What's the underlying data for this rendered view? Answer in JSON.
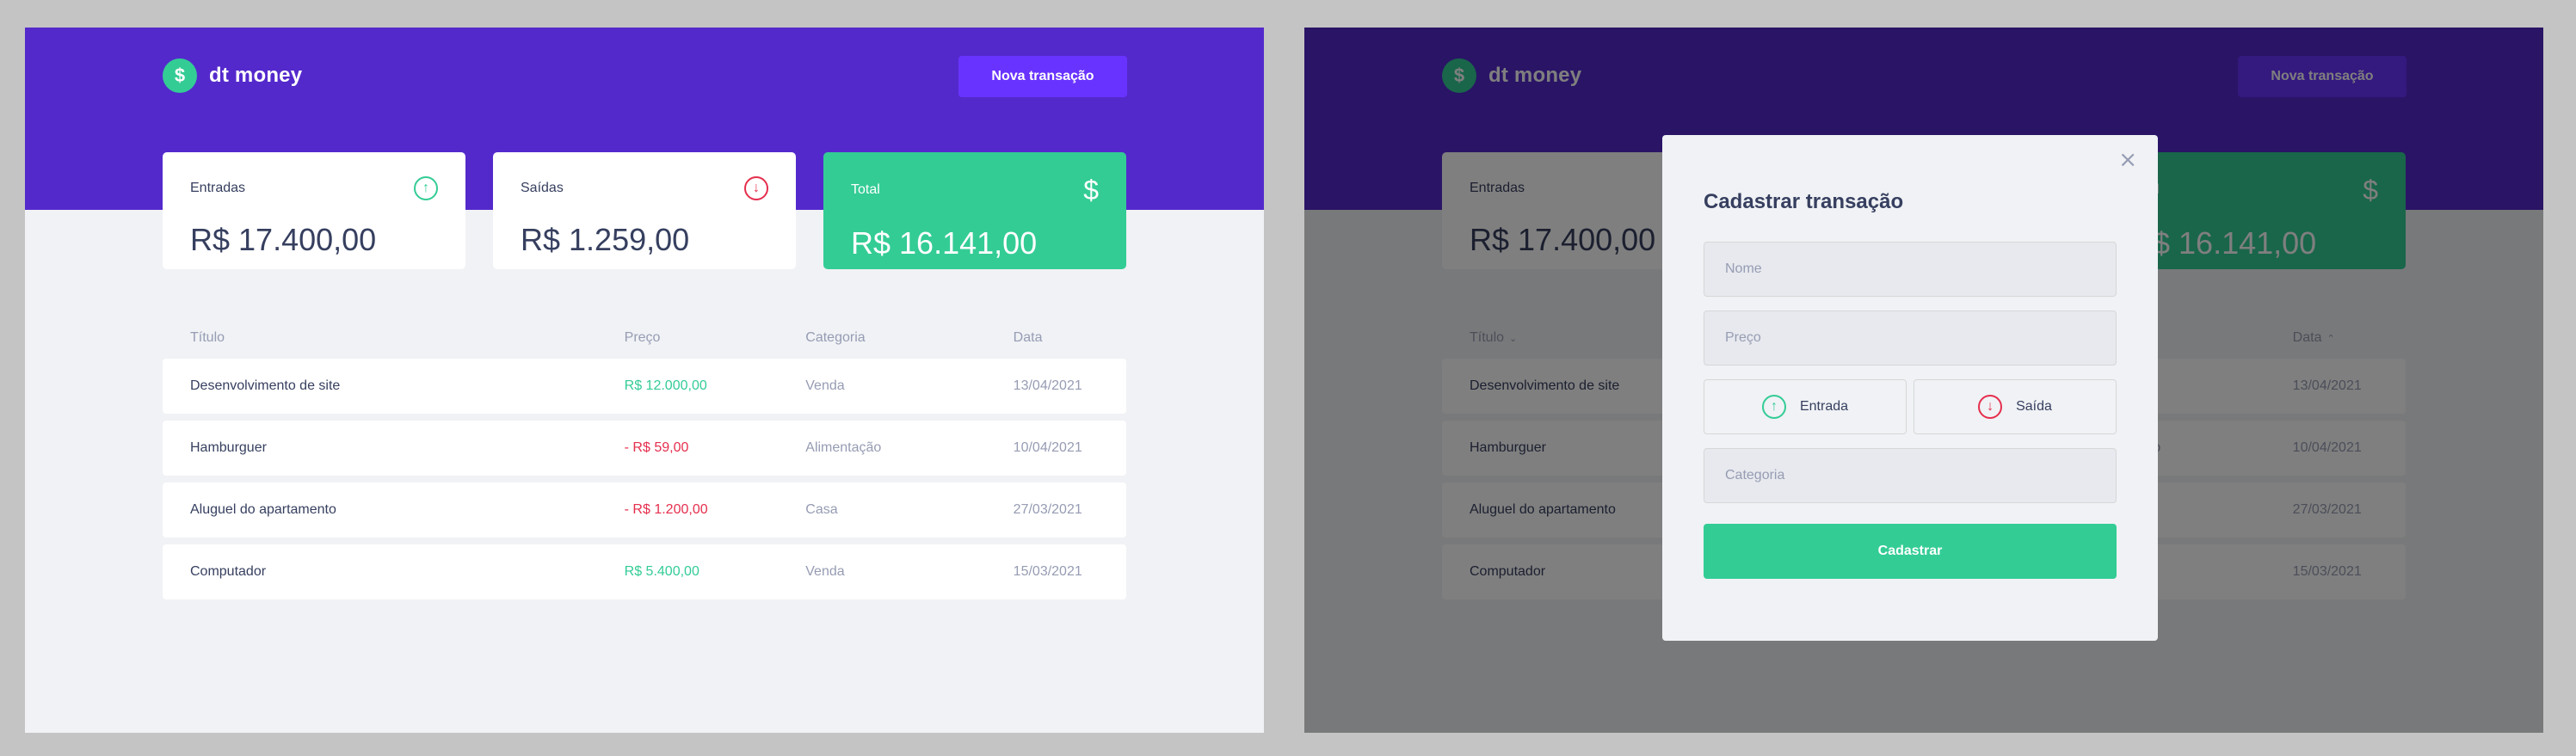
{
  "app": {
    "logo_symbol": "$",
    "logo_text": "dt money",
    "new_transaction_label": "Nova transação"
  },
  "summary": {
    "income": {
      "label": "Entradas",
      "value": "R$ 17.400,00",
      "icon": "arrow-circle-up-icon"
    },
    "outcome": {
      "label": "Saídas",
      "value": "R$ 1.259,00",
      "icon": "arrow-circle-down-icon"
    },
    "total": {
      "label": "Total",
      "value": "R$ 16.141,00",
      "icon": "dollar-icon",
      "symbol": "$"
    }
  },
  "table": {
    "headers": {
      "title": "Título",
      "price": "Preço",
      "category": "Categoria",
      "date": "Data"
    },
    "rows": [
      {
        "title": "Desenvolvimento de site",
        "price": "R$ 12.000,00",
        "type": "income",
        "category": "Venda",
        "date": "13/04/2021"
      },
      {
        "title": "Hamburguer",
        "price": "- R$ 59,00",
        "type": "outcome",
        "category": "Alimentação",
        "date": "10/04/2021"
      },
      {
        "title": "Aluguel do apartamento",
        "price": "- R$ 1.200,00",
        "type": "outcome",
        "category": "Casa",
        "date": "27/03/2021"
      },
      {
        "title": "Computador",
        "price": "R$ 5.400,00",
        "type": "income",
        "category": "Venda",
        "date": "15/03/2021"
      }
    ]
  },
  "modal": {
    "title": "Cadastrar transação",
    "close_symbol": "×",
    "name_placeholder": "Nome",
    "price_placeholder": "Preço",
    "income_label": "Entrada",
    "outcome_label": "Saída",
    "category_placeholder": "Categoria",
    "submit_label": "Cadastrar"
  },
  "colors": {
    "header": "#5429cc",
    "button": "#6933ff",
    "green": "#33cc95",
    "red": "#e52e4d",
    "background": "#f0f2f5",
    "text_title": "#363f5f",
    "text_body": "#969cb3"
  }
}
